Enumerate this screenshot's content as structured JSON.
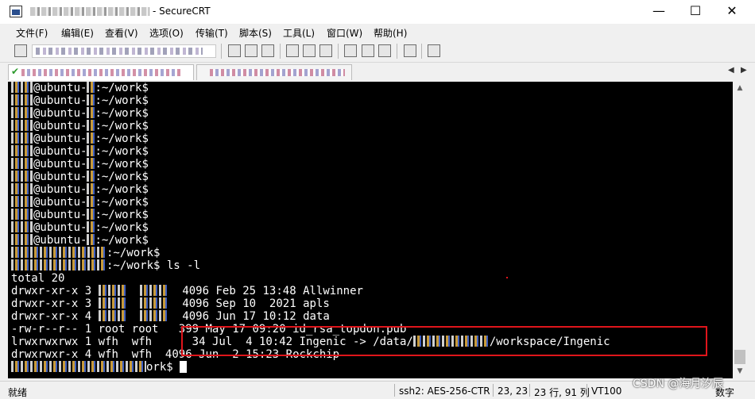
{
  "window": {
    "title_suffix": "- SecureCRT",
    "minimize_glyph": "—",
    "maximize_glyph": "☐",
    "close_glyph": "✕"
  },
  "menu": [
    {
      "label": "文件(F)"
    },
    {
      "label": "编辑(E)"
    },
    {
      "label": "查看(V)"
    },
    {
      "label": "选项(O)"
    },
    {
      "label": "传输(T)"
    },
    {
      "label": "脚本(S)"
    },
    {
      "label": "工具(L)"
    },
    {
      "label": "窗口(W)"
    },
    {
      "label": "帮助(H)"
    }
  ],
  "terminal": {
    "prompt_host": "@ubuntu-",
    "prompt_path": ":~/work$",
    "ls_command": " ls -l",
    "total": "total 20",
    "entries": [
      {
        "perm": "drwxr-xr-x",
        "links": "3",
        "size": "4096",
        "date": "Feb 25 13:48",
        "name": "Allwinner"
      },
      {
        "perm": "drwxr-xr-x",
        "links": "3",
        "size": "4096",
        "date": "Sep 10  2021",
        "name": "apls"
      },
      {
        "perm": "drwxr-xr-x",
        "links": "4",
        "size": "4096",
        "date": "Jun 17 10:12",
        "name": "data"
      },
      {
        "perm": "-rw-r--r--",
        "links": "1",
        "owner": "root",
        "group": "root",
        "size": " 399",
        "date": "May 17 09:20",
        "name": "id_rsa_topdon.pub"
      },
      {
        "perm": "lrwxrwxrwx",
        "links": "1",
        "owner": "wfh",
        "group": "wfh",
        "size": "  34",
        "date": "Jul  4 10:42",
        "name": "Ingenic -> /data/",
        "name_tail": "/workspace/Ingenic"
      },
      {
        "perm": "drwxrwxr-x",
        "links": "4",
        "owner": "wfh",
        "group": "wfh",
        "size": "4096",
        "date": "Jun  2 15:23",
        "name": "Rockchip"
      }
    ],
    "last_prompt": "ork$"
  },
  "status": {
    "ready": "就绪",
    "cipher": "ssh2: AES-256-CTR",
    "cursor_pos": "23,  23",
    "size": "23 行, 91 列",
    "terminal_type": "VT100",
    "num": "数字"
  },
  "watermark": "CSDN @海月汐辰"
}
